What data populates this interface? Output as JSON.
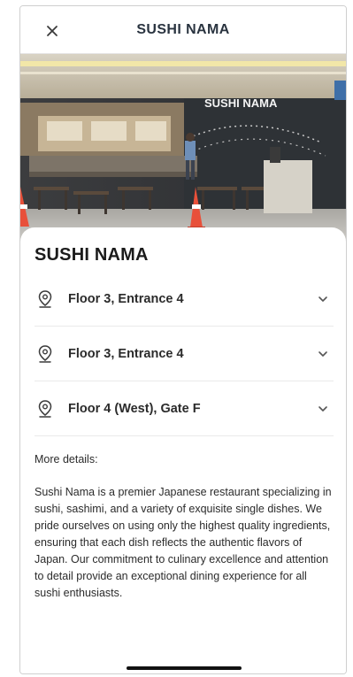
{
  "header": {
    "title": "SUSHI NAMA",
    "close_icon": "close-icon"
  },
  "hero": {
    "sign_text": "SUSHI NAMA",
    "alt_description_icon": "restaurant-photo"
  },
  "restaurant": {
    "name": "SUSHI NAMA"
  },
  "locations": [
    {
      "label": "Floor 3, Entrance 4",
      "icon": "location-pin-icon",
      "expand_icon": "chevron-down-icon"
    },
    {
      "label": "Floor 3, Entrance 4",
      "icon": "location-pin-icon",
      "expand_icon": "chevron-down-icon"
    },
    {
      "label": "Floor 4 (West), Gate F",
      "icon": "location-pin-icon",
      "expand_icon": "chevron-down-icon"
    }
  ],
  "details": {
    "label": "More details:",
    "text": "Sushi Nama is a premier Japanese restaurant specializing in sushi, sashimi, and a variety of exquisite single dishes. We pride ourselves on using only the highest quality ingredients, ensuring that each dish reflects the authentic flavors of Japan. Our commitment to culinary excellence and attention to detail provide an exceptional dining experience for all sushi enthusiasts."
  },
  "colors": {
    "title": "#2a3440",
    "text": "#2b2b2b",
    "divider": "#eaeaea",
    "cone": "#e8503a"
  }
}
